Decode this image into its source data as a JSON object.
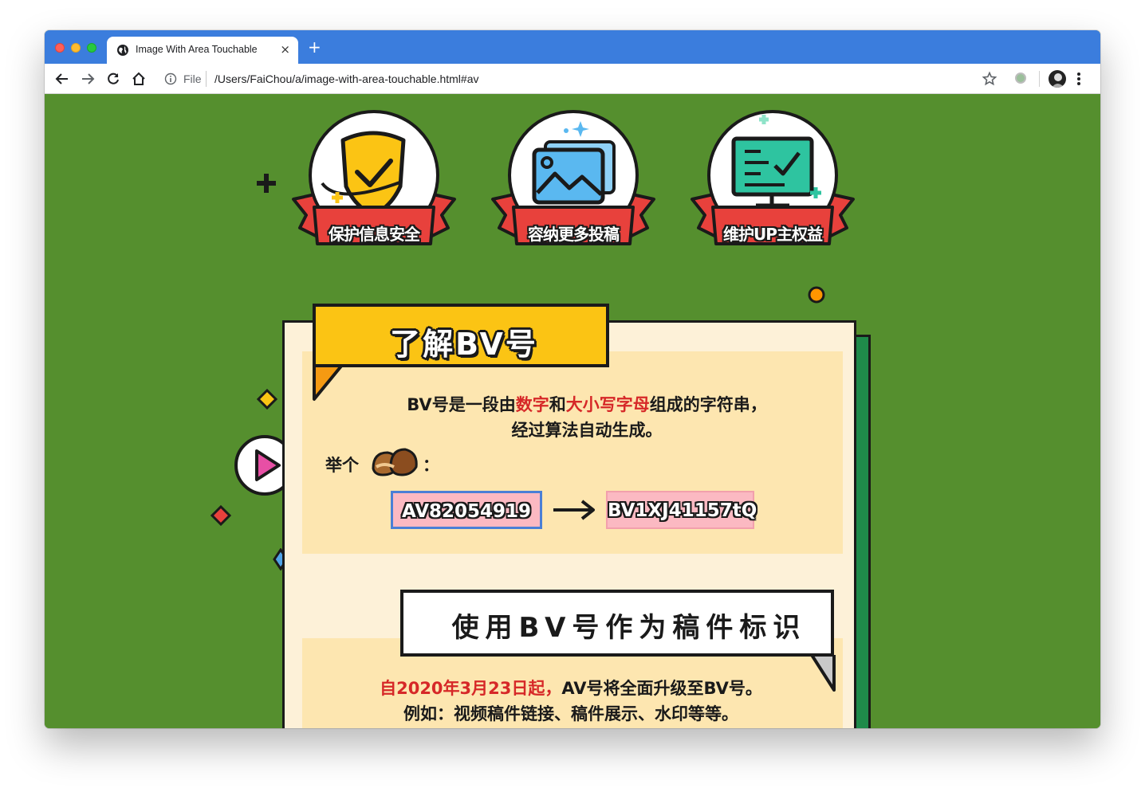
{
  "browser": {
    "tab_title": "Image With Area Touchable",
    "tab_close": "×",
    "new_tab": "+",
    "url_scheme": "File",
    "url_path": "/Users/FaiChou/a/image-with-area-touchable.html#av"
  },
  "badges": [
    {
      "label": "保护信息安全",
      "icon": "shield-check-icon"
    },
    {
      "label": "容纳更多投稿",
      "icon": "image-gallery-icon"
    },
    {
      "label": "维护UP主权益",
      "icon": "monitor-checklist-icon"
    }
  ],
  "section1": {
    "title": "了解BV号",
    "desc_line1": {
      "pre": "BV号是一段由",
      "red1": "数字",
      "mid": "和",
      "red2": "大小写字母",
      "post": "组成的字符串，"
    },
    "desc_line2": "经过算法自动生成。",
    "example_label": "举个",
    "example_colon": "：",
    "av_code": "AV82054919",
    "bv_code": "BV1XJ41157tQ"
  },
  "section2": {
    "title": "使用BV号作为稿件标识",
    "line1_red": "自2020年3月23日起，",
    "line1_rest": "AV号将全面升级至BV号。",
    "line2": "例如：视频稿件链接、稿件展示、水印等等。"
  },
  "colors": {
    "background": "#558f2e",
    "title_yellow": "#fbc414",
    "panel": "#fde6b0",
    "accent_red": "#d62828",
    "code_pink": "#fbb9c2",
    "tab_bar": "#3b7ddd"
  }
}
